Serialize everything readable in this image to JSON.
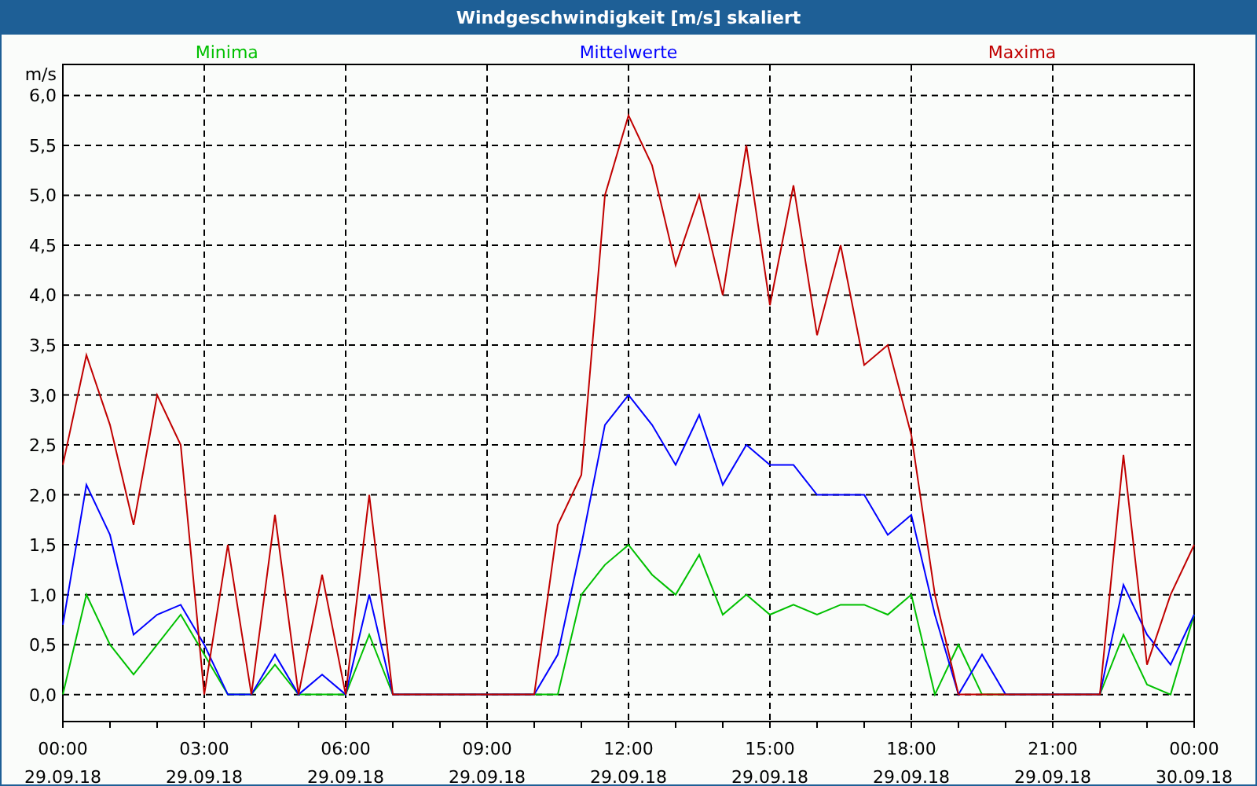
{
  "window": {
    "title": "Windgeschwindigkeit [m/s] skaliert"
  },
  "chart": {
    "chart_data": {
      "type": "line",
      "grid": true,
      "ylabel": "m/s",
      "categories": [
        "00:00\n29.09.18",
        null,
        null,
        null,
        null,
        null,
        "03:00\n29.09.18",
        null,
        null,
        null,
        null,
        null,
        "06:00\n29.09.18",
        null,
        null,
        null,
        null,
        null,
        "09:00\n29.09.18",
        null,
        null,
        null,
        null,
        null,
        "12:00\n29.09.18",
        null,
        null,
        null,
        null,
        null,
        "15:00\n29.09.18",
        null,
        null,
        null,
        null,
        null,
        "18:00\n29.09.18",
        null,
        null,
        null,
        null,
        null,
        "21:00\n29.09.18",
        null,
        null,
        null,
        null,
        null,
        "00:00\n30.09.18"
      ],
      "ylim": [
        -0.27,
        6.31
      ],
      "yticks": [
        {
          "value": 0,
          "label": "0,0"
        },
        {
          "value": 0.5,
          "label": "0,5"
        },
        {
          "value": 1,
          "label": "1,0"
        },
        {
          "value": 1.5,
          "label": "1,5"
        },
        {
          "value": 2,
          "label": "2,0"
        },
        {
          "value": 2.5,
          "label": "2,5"
        },
        {
          "value": 3,
          "label": "3,0"
        },
        {
          "value": 3.5,
          "label": "3,5"
        },
        {
          "value": 4,
          "label": "4,0"
        },
        {
          "value": 4.5,
          "label": "4,5"
        },
        {
          "value": 5,
          "label": "5,0"
        },
        {
          "value": 5.5,
          "label": "5,5"
        },
        {
          "value": 6,
          "label": "6,0"
        }
      ],
      "series": [
        {
          "name": "Minima",
          "color": "#00c000",
          "values": [
            0,
            1.0,
            0.5,
            0.2,
            0.5,
            0.8,
            0.4,
            0,
            0,
            0.3,
            0,
            0,
            0,
            0.6,
            0,
            0,
            0,
            0,
            0,
            0,
            0,
            0,
            1.0,
            1.3,
            1.5,
            1.2,
            1.0,
            1.4,
            0.8,
            1.0,
            0.8,
            0.9,
            0.8,
            0.9,
            0.9,
            0.8,
            1.0,
            0,
            0.5,
            0,
            0,
            0,
            0,
            0,
            0,
            0.6,
            0.1,
            0,
            0.8
          ]
        },
        {
          "name": "Mittelwerte",
          "color": "#0000ff",
          "values": [
            0.7,
            2.1,
            1.6,
            0.6,
            0.8,
            0.9,
            0.5,
            0,
            0,
            0.4,
            0,
            0.2,
            0,
            1.0,
            0,
            0,
            0,
            0,
            0,
            0,
            0,
            0.4,
            1.5,
            2.7,
            3.0,
            2.7,
            2.3,
            2.8,
            2.1,
            2.5,
            2.3,
            2.3,
            2.0,
            2.0,
            2.0,
            1.6,
            1.8,
            0.8,
            0,
            0.4,
            0,
            0,
            0,
            0,
            0,
            1.1,
            0.6,
            0.3,
            0.8
          ]
        },
        {
          "name": "Maxima",
          "color": "#c00000",
          "values": [
            2.3,
            3.4,
            2.7,
            1.7,
            3.0,
            2.5,
            0,
            1.5,
            0,
            1.8,
            0,
            1.2,
            0,
            2.0,
            0,
            0,
            0,
            0,
            0,
            0,
            0,
            1.7,
            2.2,
            5.0,
            5.8,
            5.3,
            4.3,
            5.0,
            4.0,
            5.5,
            3.9,
            5.1,
            3.6,
            4.5,
            3.3,
            3.5,
            2.6,
            1.0,
            0,
            0,
            0,
            0,
            0,
            0,
            0,
            2.4,
            0.3,
            1.0,
            1.5
          ]
        }
      ]
    }
  }
}
